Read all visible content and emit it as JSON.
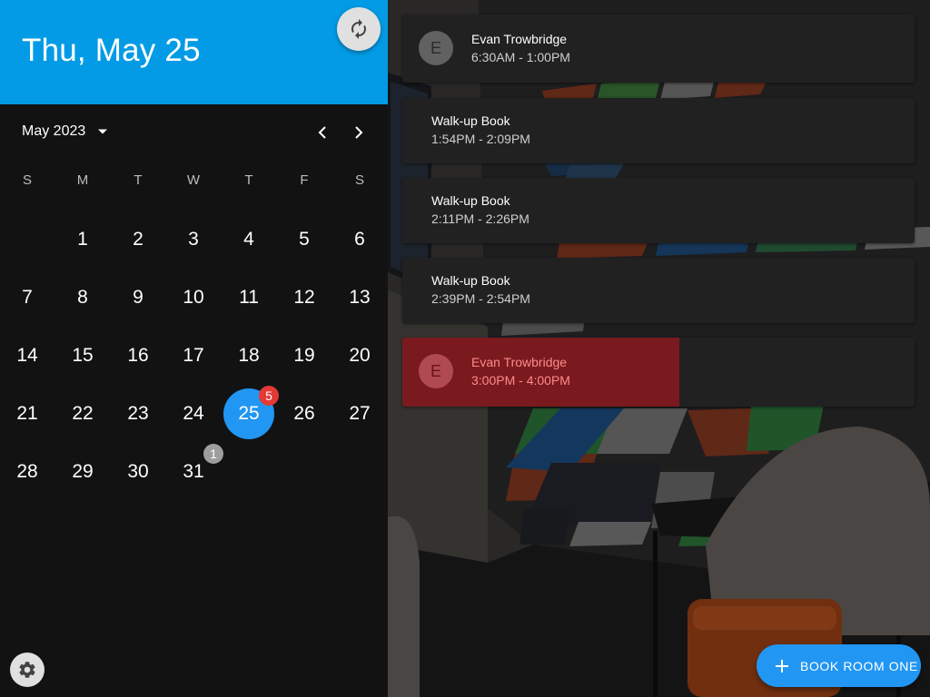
{
  "header": {
    "date": "Thu, May 25"
  },
  "calendar": {
    "month_label": "May 2023",
    "weekdays": [
      "S",
      "M",
      "T",
      "W",
      "T",
      "F",
      "S"
    ],
    "days": [
      {
        "n": "1"
      },
      {
        "n": "2"
      },
      {
        "n": "3"
      },
      {
        "n": "4"
      },
      {
        "n": "5"
      },
      {
        "n": "6"
      },
      {
        "n": "7"
      },
      {
        "n": "8"
      },
      {
        "n": "9"
      },
      {
        "n": "10"
      },
      {
        "n": "11"
      },
      {
        "n": "12"
      },
      {
        "n": "13"
      },
      {
        "n": "14"
      },
      {
        "n": "15"
      },
      {
        "n": "16"
      },
      {
        "n": "17"
      },
      {
        "n": "18"
      },
      {
        "n": "19"
      },
      {
        "n": "20"
      },
      {
        "n": "21"
      },
      {
        "n": "22"
      },
      {
        "n": "23"
      },
      {
        "n": "24"
      },
      {
        "n": "25",
        "selected": true,
        "badge": "5"
      },
      {
        "n": "26"
      },
      {
        "n": "27"
      },
      {
        "n": "28"
      },
      {
        "n": "29"
      },
      {
        "n": "30"
      },
      {
        "n": "31",
        "badge": "1"
      }
    ],
    "start_weekday": 1,
    "selected_color": "#2196f3",
    "badge_colors": {
      "today": "#e53935",
      "other": "#9e9e9e"
    }
  },
  "events": [
    {
      "title": "Evan Trowbridge",
      "time": "6:30AM - 1:00PM",
      "avatar": "E"
    },
    {
      "title": "Walk-up Book",
      "time": "1:54PM - 2:09PM"
    },
    {
      "title": "Walk-up Book",
      "time": "2:11PM - 2:26PM"
    },
    {
      "title": "Walk-up Book",
      "time": "2:39PM - 2:54PM"
    },
    {
      "title": "Evan Trowbridge",
      "time": "3:00PM - 4:00PM",
      "avatar": "E",
      "active": true,
      "progress": 0.54
    }
  ],
  "actions": {
    "book_label": "BOOK ROOM ONE"
  },
  "icons": {
    "refresh": "refresh-icon",
    "settings": "gear-icon",
    "prev": "chevron-left-icon",
    "next": "chevron-right-icon",
    "dropdown": "caret-down-icon",
    "add": "plus-icon"
  },
  "colors": {
    "header": "#039be5",
    "accent": "#2196f3",
    "active_event": "#7a1a1f",
    "panel": "#121212"
  }
}
